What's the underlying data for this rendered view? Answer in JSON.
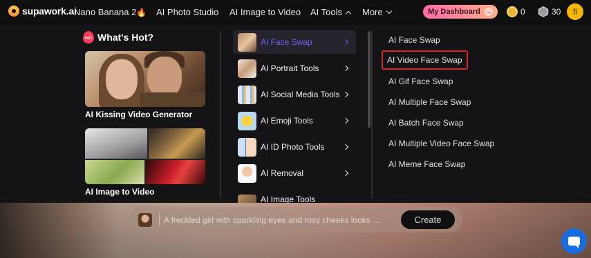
{
  "nav": {
    "logo_text": "supawork.ai",
    "items": [
      {
        "label": "Nano Banana 2",
        "suffix": "🔥"
      },
      {
        "label": "AI Photo Studio"
      },
      {
        "label": "AI Image to Video"
      },
      {
        "label": "AI Tools"
      },
      {
        "label": "More"
      }
    ],
    "dashboard_label": "My Dashboard",
    "gold_count": "0",
    "silver_count": "30",
    "avatar_initial": "fi"
  },
  "hot": {
    "title": "What's Hot?",
    "badge": "HOT",
    "cards": [
      {
        "label": "AI Kissing Video Generator"
      },
      {
        "label": "AI Image to Video"
      }
    ]
  },
  "categories": [
    {
      "label": "AI Face Swap",
      "active": true
    },
    {
      "label": "AI Portrait Tools"
    },
    {
      "label": "AI Social Media Tools"
    },
    {
      "label": "AI Emoji Tools"
    },
    {
      "label": "AI ID Photo Tools"
    },
    {
      "label": "AI Removal"
    },
    {
      "label": "AI Image Tools"
    }
  ],
  "options": [
    {
      "label": "AI Face Swap"
    },
    {
      "label": "AI Video Face Swap",
      "highlighted": true
    },
    {
      "label": "AI Gif Face Swap"
    },
    {
      "label": "AI Multiple Face Swap"
    },
    {
      "label": "AI Batch Face Swap"
    },
    {
      "label": "AI Multiple Video Face Swap"
    },
    {
      "label": "AI Meme Face Swap"
    }
  ],
  "prompt": {
    "text": "A freckled girl with sparkling eyes and rosy cheeks looks dir...",
    "create_label": "Create"
  },
  "colors": {
    "accent": "#7b5cff",
    "highlight_outline": "#d9252a",
    "dashboard_gradient_start": "#ff6aa8",
    "dashboard_gradient_end": "#ffb08a",
    "chat_button": "#1a6de0"
  },
  "icons": {
    "logo": "logo-mark-icon",
    "hot": "hot-flame-icon",
    "chevron": "chevron-icon",
    "gold": "gold-coin-icon",
    "silver": "silver-gem-icon",
    "chat": "chat-bubble-icon"
  }
}
